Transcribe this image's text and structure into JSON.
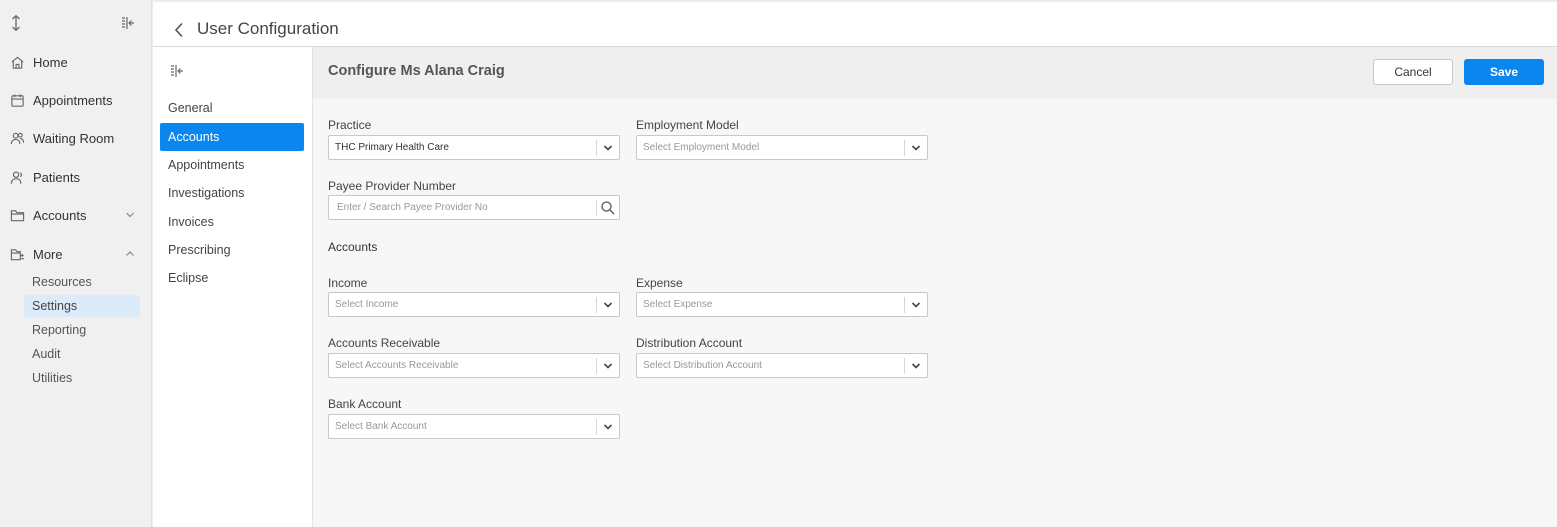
{
  "sidebar": {
    "nav": [
      {
        "label": "Home",
        "icon": "home-icon"
      },
      {
        "label": "Appointments",
        "icon": "calendar-icon"
      },
      {
        "label": "Waiting Room",
        "icon": "users-icon"
      },
      {
        "label": "Patients",
        "icon": "user-icon"
      },
      {
        "label": "Accounts",
        "icon": "folder-icon"
      },
      {
        "label": "More",
        "icon": "folder-tree-icon"
      }
    ],
    "sub_items": [
      "Resources",
      "Settings",
      "Reporting",
      "Audit",
      "Utilities"
    ],
    "active_sub_item": "Settings"
  },
  "header": {
    "title": "User Configuration"
  },
  "config_menu": {
    "items": [
      "General",
      "Accounts",
      "Appointments",
      "Investigations",
      "Invoices",
      "Prescribing",
      "Eclipse"
    ],
    "active": "Accounts"
  },
  "content": {
    "title": "Configure Ms Alana Craig",
    "cancel_label": "Cancel",
    "save_label": "Save",
    "practice": {
      "label": "Practice",
      "value": "THC Primary Health Care"
    },
    "employment_model": {
      "label": "Employment Model",
      "placeholder": "Select Employment Model"
    },
    "payee_provider": {
      "label": "Payee Provider Number",
      "placeholder": "Enter / Search Payee Provider No"
    },
    "accounts_section": "Accounts",
    "income": {
      "label": "Income",
      "placeholder": "Select Income"
    },
    "expense": {
      "label": "Expense",
      "placeholder": "Select Expense"
    },
    "accounts_receivable": {
      "label": "Accounts Receivable",
      "placeholder": "Select Accounts Receivable"
    },
    "distribution_account": {
      "label": "Distribution Account",
      "placeholder": "Select Distribution Account"
    },
    "bank_account": {
      "label": "Bank Account",
      "placeholder": "Select Bank Account"
    }
  },
  "colors": {
    "accent": "#0b86ee",
    "active_sub_item_bg": "#dcebf9"
  }
}
